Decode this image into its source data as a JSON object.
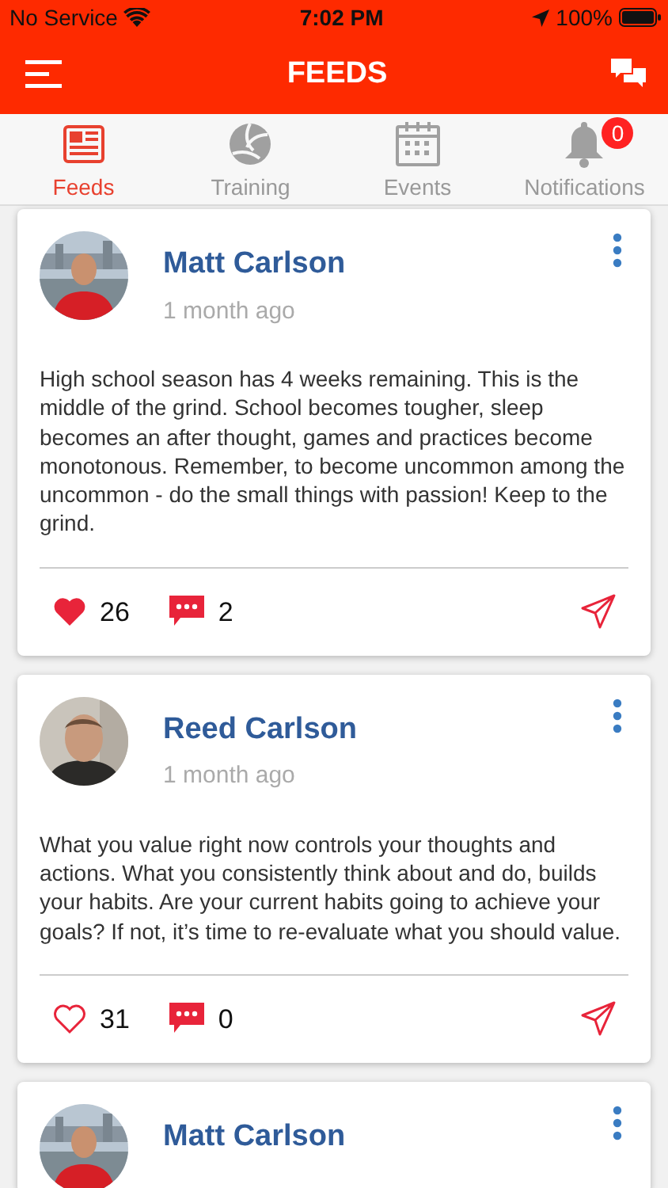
{
  "status_bar": {
    "carrier": "No Service",
    "time": "7:02 PM",
    "battery": "100%"
  },
  "header": {
    "title": "FEEDS"
  },
  "tabs": [
    {
      "label": "Feeds",
      "kind": "news",
      "selected": true
    },
    {
      "label": "Training",
      "kind": "ball",
      "selected": false
    },
    {
      "label": "Events",
      "kind": "calendar",
      "selected": false
    },
    {
      "label": "Notifications",
      "kind": "bell",
      "selected": false,
      "badge": "0"
    }
  ],
  "posts": [
    {
      "author": "Matt Carlson",
      "time": "1 month ago",
      "text": "High school season has 4 weeks remaining. This is the middle of the grind. School becomes tougher, sleep becomes an after thought, games and practices become monotonous. Remember, to become uncommon among the uncommon - do the small things with passion! Keep to the grind.",
      "likes": "26",
      "liked": true,
      "comments": "2"
    },
    {
      "author": "Reed Carlson",
      "time": "1 month ago",
      "text": "What you value right now controls your thoughts and actions.  What you consistently think about and do, builds your habits.  Are your current habits going to achieve your goals?  If not, it’s time to re-evaluate what you should value.",
      "likes": "31",
      "liked": false,
      "comments": "0"
    },
    {
      "author": "Matt Carlson"
    }
  ]
}
